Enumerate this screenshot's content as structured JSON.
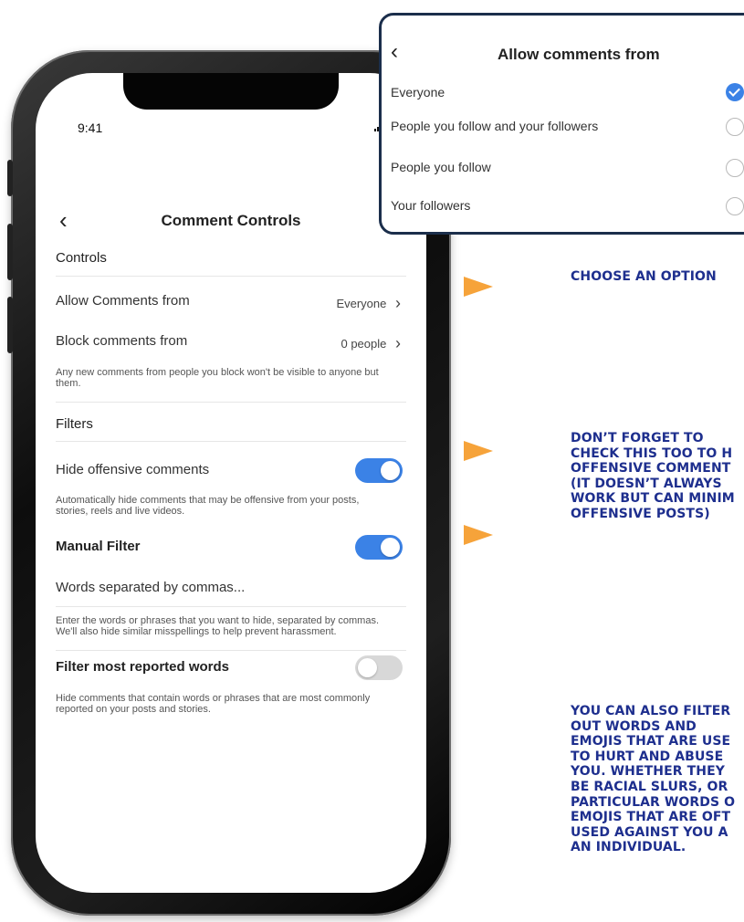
{
  "phone": {
    "status_bar": {
      "time": "9:41",
      "signal": "‥▎ ◠"
    },
    "nav": {
      "back_glyph": "‹",
      "title": "Comment Controls"
    },
    "controls": {
      "heading": "Controls",
      "allow_label": "Allow Comments from",
      "allow_value": "Everyone",
      "block_label": "Block comments from",
      "block_value": "0 people",
      "chevron": "›",
      "block_note": "Any new comments from people you block won't be visible to anyone but them."
    },
    "filters": {
      "heading": "Filters",
      "hide_offensive_label": "Hide offensive comments",
      "hide_offensive_on": true,
      "hide_offensive_note": "Automatically hide comments that may be offensive from your posts, stories, reels and live videos.",
      "manual_label": "Manual Filter",
      "manual_on": true,
      "manual_placeholder": "Words separated by commas...",
      "manual_note": "Enter the words or phrases that you want to hide, separated by commas. We'll also hide similar misspellings to help prevent harassment.",
      "most_reported_label": "Filter most reported words",
      "most_reported_on": false,
      "most_reported_note": "Hide comments that contain words or phrases that are most commonly reported on your posts and stories."
    }
  },
  "popout": {
    "back_glyph": "‹",
    "title": "Allow comments from",
    "options": [
      {
        "label": "Everyone",
        "selected": true
      },
      {
        "label": "People you follow and your followers",
        "selected": false
      },
      {
        "label": "People you follow",
        "selected": false
      },
      {
        "label": "Your followers",
        "selected": false
      }
    ]
  },
  "annotations": {
    "choose": "CHOOSE AN OPTION",
    "dont_forget": "DON’T FORGET TO\nCHECK THIS TOO TO H\nOFFENSIVE COMMENT\n(IT DOESN’T ALWAYS\nWORK BUT CAN MINIM\nOFFENSIVE POSTS)",
    "filter_words": "YOU CAN ALSO FILTER\nOUT WORDS AND\nEMOJIS THAT ARE USE\nTO HURT AND ABUSE\nYOU. WHETHER THEY\nBE RACIAL SLURS, OR\nPARTICULAR WORDS O\nEMOJIS THAT ARE OFT\nUSED AGAINST YOU A\nAN INDIVIDUAL."
  },
  "colors": {
    "accent": "#3b82e6",
    "arrow": "#f6a33a",
    "callout_text": "#1e2f8e",
    "popout_border": "#1b2e4b"
  }
}
